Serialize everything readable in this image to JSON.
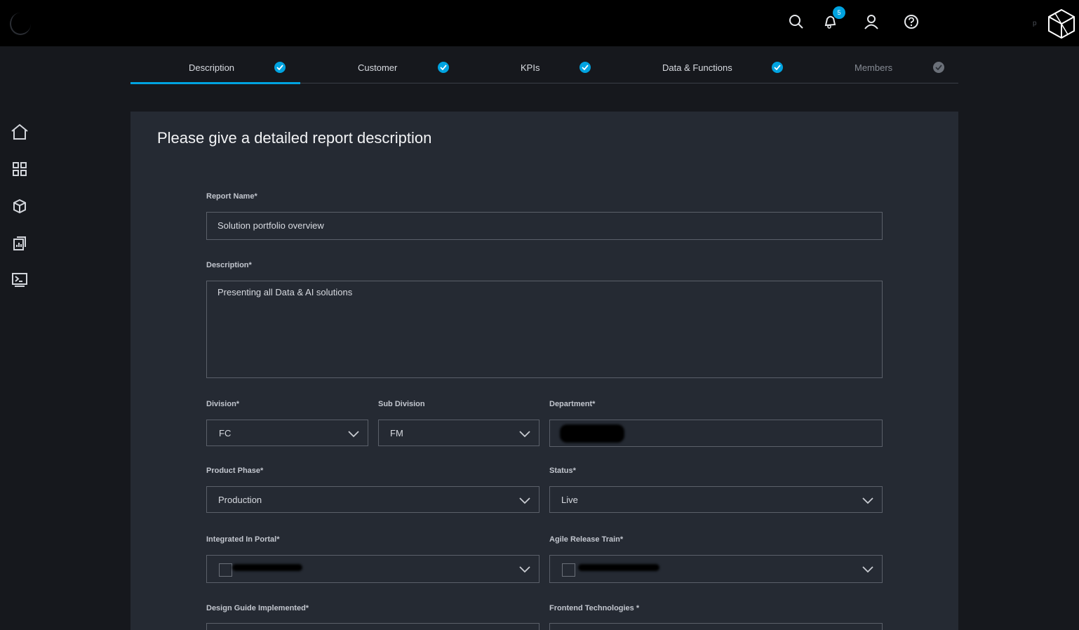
{
  "header": {
    "notification_count": "5",
    "user_initial": "p",
    "icons": [
      "search-icon",
      "bell-icon",
      "user-icon",
      "help-icon",
      "brand-cube-icon"
    ]
  },
  "sidebar": {
    "items": [
      "home-icon",
      "grid-icon",
      "cube-icon",
      "report-icon",
      "terminal-icon"
    ]
  },
  "tabs": [
    {
      "label": "Description",
      "state": "active"
    },
    {
      "label": "Customer",
      "state": "done"
    },
    {
      "label": "KPIs",
      "state": "done"
    },
    {
      "label": "Data & Functions",
      "state": "done"
    },
    {
      "label": "Members",
      "state": "pending"
    }
  ],
  "form": {
    "title": "Please give a detailed report description",
    "report_name": {
      "label": "Report Name*",
      "value": "Solution portfolio overview"
    },
    "description": {
      "label": "Description*",
      "value": "Presenting all Data & AI solutions"
    },
    "division": {
      "label": "Division*",
      "value": "FC"
    },
    "sub_division": {
      "label": "Sub Division",
      "value": "FM"
    },
    "department": {
      "label": "Department*"
    },
    "product_phase": {
      "label": "Product Phase*",
      "value": "Production"
    },
    "status": {
      "label": "Status*",
      "value": "Live"
    },
    "integrated_in_portal": {
      "label": "Integrated In Portal*"
    },
    "agile_release_train": {
      "label": "Agile Release Train*"
    },
    "design_guide": {
      "label": "Design Guide Implemented*"
    },
    "frontend_technologies": {
      "label": "Frontend Technologies *"
    }
  },
  "colors": {
    "accent": "#00a3e0",
    "panel": "#252a33",
    "background": "#16181d"
  }
}
